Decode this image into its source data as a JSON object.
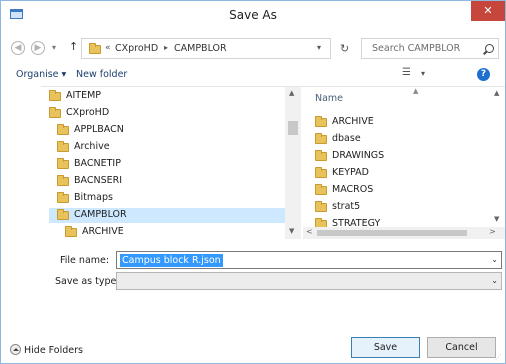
{
  "window": {
    "title": "Save As",
    "close_label": "✕"
  },
  "nav": {
    "back": "◀",
    "forward": "▶",
    "recent": "▾",
    "up": "↑"
  },
  "address": {
    "overflow_chevron": "«",
    "crumbs": [
      "CXproHD",
      "CAMPBLOR"
    ],
    "separator": "▸",
    "dropdown": "▾",
    "refresh": "↻"
  },
  "search": {
    "placeholder": "Search CAMPBLOR"
  },
  "toolbar": {
    "organise_label": "Organise ▾",
    "new_folder_label": "New folder",
    "view_icon": "☰",
    "view_dropdown": "▾",
    "help_label": "?"
  },
  "tree": {
    "items": [
      {
        "label": "AITEMP",
        "level": 1
      },
      {
        "label": "CXproHD",
        "level": 1
      },
      {
        "label": "APPLBACN",
        "level": 2
      },
      {
        "label": "Archive",
        "level": 2
      },
      {
        "label": "BACNETIP",
        "level": 2
      },
      {
        "label": "BACNSERI",
        "level": 2
      },
      {
        "label": "Bitmaps",
        "level": 2
      },
      {
        "label": "CAMPBLOR",
        "level": 2,
        "selected": true
      },
      {
        "label": "ARCHIVE",
        "level": 3
      }
    ]
  },
  "files": {
    "column_name": "Name",
    "items": [
      "ARCHIVE",
      "dbase",
      "DRAWINGS",
      "KEYPAD",
      "MACROS",
      "strat5",
      "STRATEGY"
    ]
  },
  "scroll": {
    "up": "▲",
    "down": "▼",
    "left": "<",
    "right": ">"
  },
  "form": {
    "file_name_label": "File name:",
    "file_name_value": "Campus block R.json",
    "save_as_type_label": "Save as type:",
    "dropdown_arrow": "⌄"
  },
  "footer": {
    "hide_folders_label": "Hide Folders",
    "save_label": "Save",
    "cancel_label": "Cancel",
    "grip": "⋰"
  }
}
